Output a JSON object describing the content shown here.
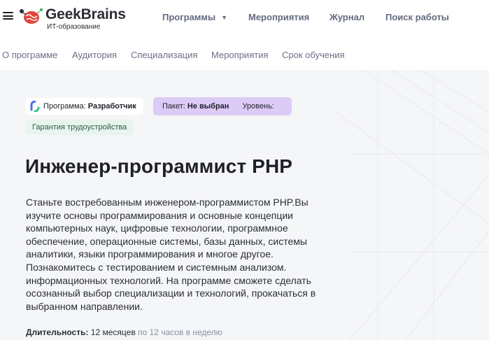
{
  "header": {
    "logo": {
      "title": "GeekBrains",
      "subtitle": "ИТ-образование"
    },
    "nav": [
      {
        "label": "Программы"
      },
      {
        "label": "Мероприятия"
      },
      {
        "label": "Журнал"
      },
      {
        "label": "Поиск работы"
      }
    ]
  },
  "subnav": {
    "items": [
      {
        "label": "О программе"
      },
      {
        "label": "Аудитория"
      },
      {
        "label": "Специализация"
      },
      {
        "label": "Мероприятия"
      },
      {
        "label": "Срок обучения"
      }
    ]
  },
  "hero": {
    "program_tag": {
      "prefix": "Программа:",
      "value": "Разработчик"
    },
    "package_tag": {
      "prefix": "Пакет:",
      "value": "Не выбран",
      "level_label": "Уровень:"
    },
    "guarantee_tag": "Гарантия трудоустройства",
    "title": "Инженер-программист PHP",
    "description": "Станьте востребованным инженером-программистом PHP.Вы изучите основы программирования и основные концепции компьютерных наук, цифровые технологии, программное обеспечение, операционные системы, базы данных, системы аналитики, языки программирования и многое другое. Познакомитесь с тестированием и системным анализом. информационных технологий. На программе сможете сделать осознанный выбор специализации и технологий, прокачаться в выбранном направлении.",
    "duration": {
      "label": "Длительность:",
      "value": "12 месяцев",
      "detail": "по 12 часов в неделю"
    }
  },
  "colors": {
    "hero_bg": "#f5f6f8",
    "package_bg": "#dccbf6",
    "guarantee_bg": "#e7f5ee",
    "logo_accent": "#e0463c"
  }
}
